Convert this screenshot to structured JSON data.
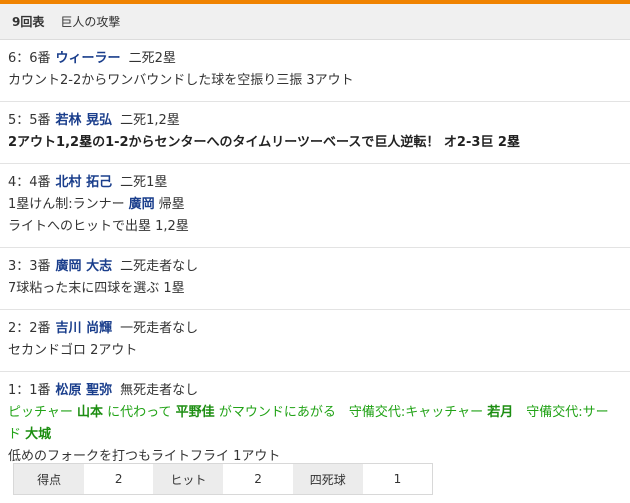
{
  "header": {
    "inning": "9回表",
    "title": "巨人の攻撃"
  },
  "plays": [
    {
      "order": "6：6番",
      "batter": "ウィーラー",
      "situation": "二死2塁",
      "lines": [
        "カウント2-2からワンバウンドした球を空振り三振 3アウト"
      ]
    },
    {
      "order": "5：5番",
      "batter": "若林 晃弘",
      "situation": "二死1,2塁",
      "bold_line": "2アウト1,2塁の1-2からセンターへのタイムリーツーベースで巨人逆転！ オ2-3巨 2塁"
    },
    {
      "order": "4：4番",
      "batter": "北村 拓己",
      "situation": "二死1塁",
      "runner_prefix": "1塁けん制:ランナー",
      "runner_name": "廣岡",
      "runner_suffix": "帰塁",
      "lines": [
        "ライトへのヒットで出塁 1,2塁"
      ]
    },
    {
      "order": "3：3番",
      "batter": "廣岡 大志",
      "situation": "二死走者なし",
      "lines": [
        "7球粘った末に四球を選ぶ 1塁"
      ]
    },
    {
      "order": "2：2番",
      "batter": "吉川 尚輝",
      "situation": "一死走者なし",
      "lines": [
        "セカンドゴロ 2アウト"
      ]
    },
    {
      "order": "1：1番",
      "batter": "松原 聖弥",
      "situation": "無死走者なし",
      "change": {
        "t1": "ピッチャー",
        "n1": "山本",
        "t2": "に代わって",
        "n2": "平野佳",
        "t3": "がマウンドにあがる　守備交代:キャッチャー",
        "n3": "若月",
        "t4": "　守備交代:サード",
        "n4": "大城"
      },
      "lines": [
        "低めのフォークを打つもライトフライ 1アウト"
      ]
    }
  ],
  "stats": {
    "runs_label": "得点",
    "runs": "2",
    "hits_label": "ヒット",
    "hits": "2",
    "walks_label": "四死球",
    "walks": "1"
  },
  "colors": {
    "accent": "#f08300",
    "batter": "#1a3e8c",
    "change": "#22a317"
  }
}
